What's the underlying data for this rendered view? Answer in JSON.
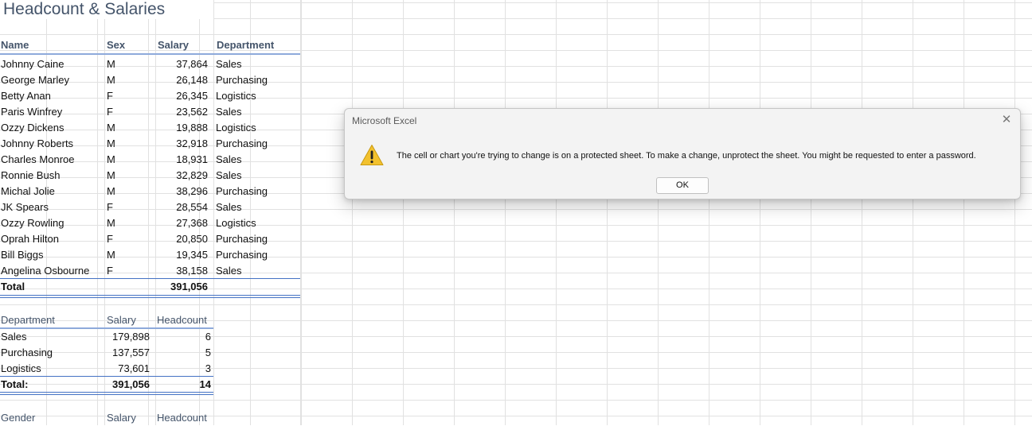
{
  "sheet": {
    "title": "Headcount & Salaries",
    "main_table": {
      "headers": {
        "name": "Name",
        "sex": "Sex",
        "salary": "Salary",
        "department": "Department"
      },
      "rows": [
        {
          "name": "Johnny Caine",
          "sex": "M",
          "salary": "37,864",
          "department": "Sales"
        },
        {
          "name": "George Marley",
          "sex": "M",
          "salary": "26,148",
          "department": "Purchasing"
        },
        {
          "name": "Betty Anan",
          "sex": "F",
          "salary": "26,345",
          "department": "Logistics"
        },
        {
          "name": "Paris Winfrey",
          "sex": "F",
          "salary": "23,562",
          "department": "Sales"
        },
        {
          "name": "Ozzy Dickens",
          "sex": "M",
          "salary": "19,888",
          "department": "Logistics"
        },
        {
          "name": "Johnny Roberts",
          "sex": "M",
          "salary": "32,918",
          "department": "Purchasing"
        },
        {
          "name": "Charles Monroe",
          "sex": "M",
          "salary": "18,931",
          "department": "Sales"
        },
        {
          "name": "Ronnie Bush",
          "sex": "M",
          "salary": "32,829",
          "department": "Sales"
        },
        {
          "name": "Michal Jolie",
          "sex": "M",
          "salary": "38,296",
          "department": "Purchasing"
        },
        {
          "name": "JK Spears",
          "sex": "F",
          "salary": "28,554",
          "department": "Sales"
        },
        {
          "name": "Ozzy Rowling",
          "sex": "M",
          "salary": "27,368",
          "department": "Logistics"
        },
        {
          "name": "Oprah Hilton",
          "sex": "F",
          "salary": "20,850",
          "department": "Purchasing"
        },
        {
          "name": "Bill Biggs",
          "sex": "M",
          "salary": "19,345",
          "department": "Purchasing"
        },
        {
          "name": "Angelina Osbourne",
          "sex": "F",
          "salary": "38,158",
          "department": "Sales"
        }
      ],
      "total_label": "Total",
      "total_salary": "391,056"
    },
    "dept_table": {
      "headers": {
        "department": "Department",
        "salary": "Salary",
        "headcount": "Headcount"
      },
      "rows": [
        {
          "department": "Sales",
          "salary": "179,898",
          "headcount": "6"
        },
        {
          "department": "Purchasing",
          "salary": "137,557",
          "headcount": "5"
        },
        {
          "department": "Logistics",
          "salary": "73,601",
          "headcount": "3"
        }
      ],
      "total_label": "Total:",
      "total_salary": "391,056",
      "total_headcount": "14"
    },
    "gender_table": {
      "headers": {
        "gender": "Gender",
        "salary": "Salary",
        "headcount": "Headcount"
      }
    }
  },
  "dialog": {
    "title": "Microsoft Excel",
    "icon": "warning-icon",
    "message": "The cell or chart you're trying to change is on a protected sheet. To make a change, unprotect the sheet. You might be requested to enter a password.",
    "ok_label": "OK",
    "close_icon": "close-icon"
  },
  "colors": {
    "header_text": "#44546a",
    "header_border": "#8eaadb",
    "total_border": "#4472c4",
    "warning": "#f2c12e"
  }
}
